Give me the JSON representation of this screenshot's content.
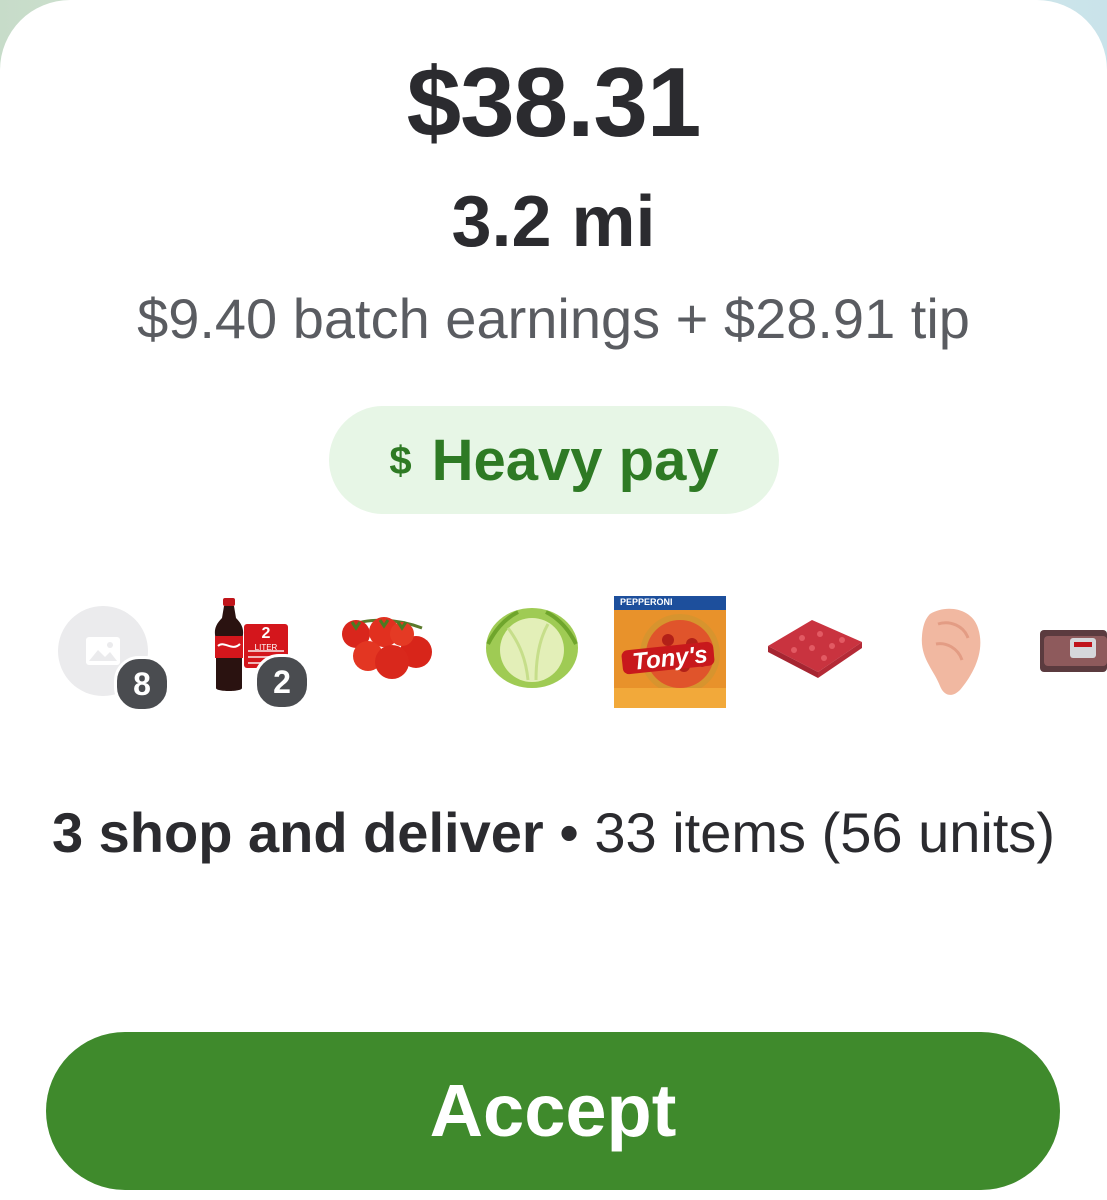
{
  "offer": {
    "total": "$38.31",
    "distance": "3.2 mi",
    "breakdown": "$9.40 batch earnings + $28.91 tip",
    "badge": {
      "icon": "dollar-icon",
      "symbol": "$",
      "label": "Heavy pay",
      "color": "#2e7a24",
      "background": "#e7f6e6"
    },
    "items": [
      {
        "name": "placeholder-image",
        "icon": "image-icon",
        "count": "8"
      },
      {
        "name": "coca-cola-2-liter",
        "count": "2",
        "bottle_label": "2",
        "bottle_sublabel": "LITER"
      },
      {
        "name": "tomatoes-on-vine"
      },
      {
        "name": "iceberg-lettuce"
      },
      {
        "name": "tonys-pepperoni-pizza",
        "brand": "Tony's",
        "flavor": "PEPPERONI"
      },
      {
        "name": "ground-beef"
      },
      {
        "name": "chicken-breast"
      },
      {
        "name": "packaged-meat"
      }
    ],
    "summary": {
      "strong": "3 shop and deliver",
      "separator": " • ",
      "rest": "33 items (56 units)"
    },
    "accept_label": "Accept",
    "accent_color": "#3f8a2c"
  }
}
